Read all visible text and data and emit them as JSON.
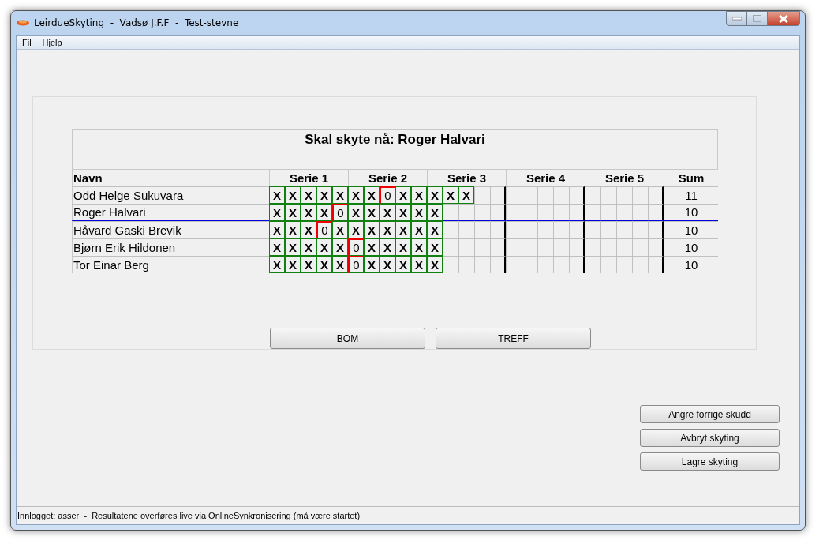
{
  "window": {
    "title": "LeirdueSkyting  -  Vadsø J.F.F  -  Test-stevne"
  },
  "menu": [
    "Fil",
    "Hjelp"
  ],
  "scoreboard": {
    "heading": "Skal skyte nå: Roger Halvari",
    "name_header": "Navn",
    "series": [
      "Serie 1",
      "Serie 2",
      "Serie 3",
      "Serie 4",
      "Serie 5"
    ],
    "sum_header": "Sum",
    "rows": [
      {
        "name": "Odd Helge Sukuvara",
        "current": false,
        "sum": "11",
        "shots": [
          {
            "mark": "X",
            "hit": true
          },
          {
            "mark": "X",
            "hit": true
          },
          {
            "mark": "X",
            "hit": true
          },
          {
            "mark": "X",
            "hit": true
          },
          {
            "mark": "X",
            "hit": true
          },
          {
            "mark": "X",
            "hit": true
          },
          {
            "mark": "X",
            "hit": true
          },
          {
            "mark": "0",
            "hit": false
          },
          {
            "mark": "X",
            "hit": true
          },
          {
            "mark": "X",
            "hit": true
          },
          {
            "mark": "X",
            "hit": true
          },
          {
            "mark": "X",
            "hit": true
          },
          {
            "mark": "X",
            "hit": true
          }
        ]
      },
      {
        "name": "Roger Halvari",
        "current": true,
        "sum": "10",
        "shots": [
          {
            "mark": "X",
            "hit": true
          },
          {
            "mark": "X",
            "hit": true
          },
          {
            "mark": "X",
            "hit": true
          },
          {
            "mark": "X",
            "hit": true
          },
          {
            "mark": "0",
            "hit": false
          },
          {
            "mark": "X",
            "hit": true
          },
          {
            "mark": "X",
            "hit": true
          },
          {
            "mark": "X",
            "hit": true
          },
          {
            "mark": "X",
            "hit": true
          },
          {
            "mark": "X",
            "hit": true
          },
          {
            "mark": "X",
            "hit": true
          }
        ]
      },
      {
        "name": "Håvard Gaski Brevik",
        "current": false,
        "sum": "10",
        "shots": [
          {
            "mark": "X",
            "hit": true
          },
          {
            "mark": "X",
            "hit": true
          },
          {
            "mark": "X",
            "hit": true
          },
          {
            "mark": "0",
            "hit": false
          },
          {
            "mark": "X",
            "hit": true
          },
          {
            "mark": "X",
            "hit": true
          },
          {
            "mark": "X",
            "hit": true
          },
          {
            "mark": "X",
            "hit": true
          },
          {
            "mark": "X",
            "hit": true
          },
          {
            "mark": "X",
            "hit": true
          },
          {
            "mark": "X",
            "hit": true
          }
        ]
      },
      {
        "name": "Bjørn Erik Hildonen",
        "current": false,
        "sum": "10",
        "shots": [
          {
            "mark": "X",
            "hit": true
          },
          {
            "mark": "X",
            "hit": true
          },
          {
            "mark": "X",
            "hit": true
          },
          {
            "mark": "X",
            "hit": true
          },
          {
            "mark": "X",
            "hit": true
          },
          {
            "mark": "0",
            "hit": false
          },
          {
            "mark": "X",
            "hit": true
          },
          {
            "mark": "X",
            "hit": true
          },
          {
            "mark": "X",
            "hit": true
          },
          {
            "mark": "X",
            "hit": true
          },
          {
            "mark": "X",
            "hit": true
          }
        ]
      },
      {
        "name": "Tor Einar Berg",
        "current": false,
        "sum": "10",
        "shots": [
          {
            "mark": "X",
            "hit": true
          },
          {
            "mark": "X",
            "hit": true
          },
          {
            "mark": "X",
            "hit": true
          },
          {
            "mark": "X",
            "hit": true
          },
          {
            "mark": "X",
            "hit": true
          },
          {
            "mark": "0",
            "hit": false
          },
          {
            "mark": "X",
            "hit": true
          },
          {
            "mark": "X",
            "hit": true
          },
          {
            "mark": "X",
            "hit": true
          },
          {
            "mark": "X",
            "hit": true
          },
          {
            "mark": "X",
            "hit": true
          }
        ]
      }
    ]
  },
  "shot_buttons": [
    "BOM",
    "TREFF"
  ],
  "side_buttons": [
    "Angre forrige skudd",
    "Avbryt skyting",
    "Lagre skyting"
  ],
  "status_bar": "Innlogget: asser  -  Resultatene overføres live via OnlineSynkronisering (må være startet)"
}
